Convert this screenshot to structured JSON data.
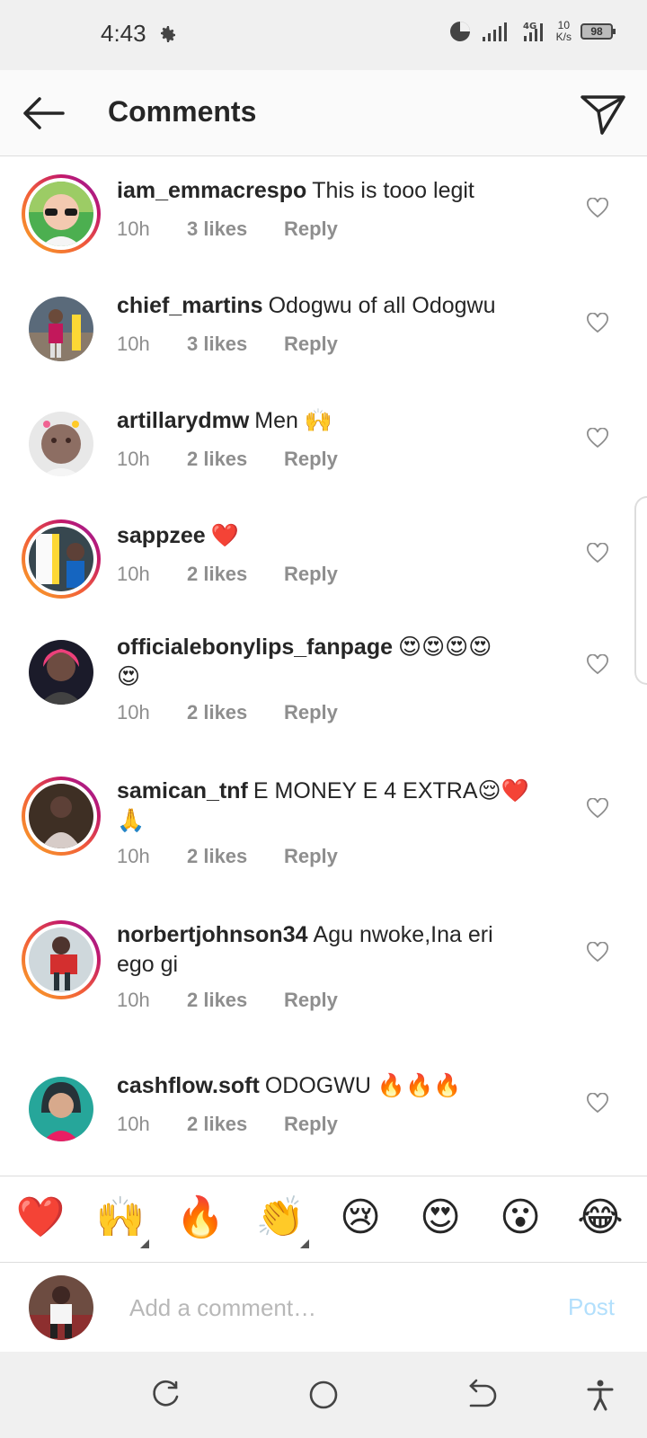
{
  "status": {
    "time": "4:43",
    "net_speed_value": "10",
    "net_speed_unit": "K/s",
    "network": "4G",
    "battery": "98"
  },
  "header": {
    "title": "Comments"
  },
  "comments": [
    {
      "user": "iam_emmacrespo",
      "text": "This is tooo legit",
      "text2": "",
      "time": "10h",
      "likes": "3 likes",
      "reply": "Reply"
    },
    {
      "user": "chief_martins",
      "text": "Odogwu of all Odogwu",
      "text2": "",
      "time": "10h",
      "likes": "3 likes",
      "reply": "Reply"
    },
    {
      "user": "artillarydmw",
      "text": "Men 🙌",
      "text2": "",
      "time": "10h",
      "likes": "2 likes",
      "reply": "Reply"
    },
    {
      "user": "sappzee",
      "text": "❤️",
      "text2": "",
      "time": "10h",
      "likes": "2 likes",
      "reply": "Reply"
    },
    {
      "user": "officialebonylips_fanpage",
      "text": "😍😍😍😍",
      "text2": "😍",
      "time": "10h",
      "likes": "2 likes",
      "reply": "Reply"
    },
    {
      "user": "samican_tnf",
      "text": "E MONEY E 4 EXTRA😌❤️",
      "text2": "🙏",
      "time": "10h",
      "likes": "2 likes",
      "reply": "Reply"
    },
    {
      "user": "norbertjohnson34",
      "text": "Agu nwoke,Ina eri",
      "text2": "ego gi",
      "time": "10h",
      "likes": "2 likes",
      "reply": "Reply"
    },
    {
      "user": "cashflow.soft",
      "text": "ODOGWU 🔥🔥🔥",
      "text2": "",
      "time": "10h",
      "likes": "2 likes",
      "reply": "Reply"
    }
  ],
  "emoji_bar": [
    "❤️",
    "🙌",
    "🔥",
    "👏",
    "😢",
    "😍",
    "😮",
    "😂"
  ],
  "composer": {
    "placeholder": "Add a comment…",
    "post_label": "Post"
  },
  "colors": {
    "ring_start": "#f9a825",
    "ring_end": "#8e24aa",
    "post_disabled": "#b2dffc",
    "meta_grey": "#8e8e8e"
  }
}
